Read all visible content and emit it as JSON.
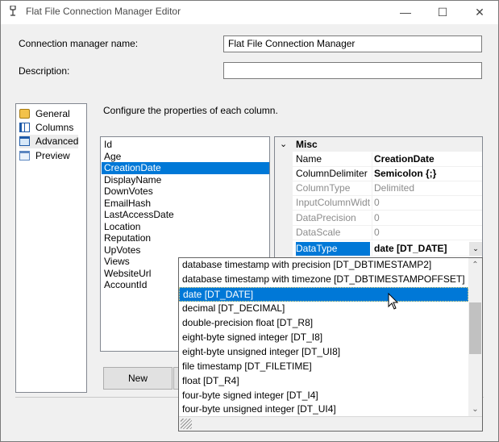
{
  "window": {
    "title": "Flat File Connection Manager Editor",
    "minimize_glyph": "—",
    "maximize_glyph": "☐",
    "close_glyph": "✕"
  },
  "form": {
    "name_label": "Connection manager name:",
    "name_value": "Flat File Connection Manager",
    "desc_label": "Description:",
    "desc_value": ""
  },
  "nav": {
    "items": [
      {
        "label": "General",
        "icon": "general-icon"
      },
      {
        "label": "Columns",
        "icon": "columns-icon"
      },
      {
        "label": "Advanced",
        "icon": "advanced-icon",
        "selected": true
      },
      {
        "label": "Preview",
        "icon": "preview-icon"
      }
    ]
  },
  "main": {
    "instruction": "Configure the properties of each column.",
    "columns": [
      "Id",
      "Age",
      "CreationDate",
      "DisplayName",
      "DownVotes",
      "EmailHash",
      "LastAccessDate",
      "Location",
      "Reputation",
      "UpVotes",
      "Views",
      "WebsiteUrl",
      "AccountId"
    ],
    "selected_column": "CreationDate"
  },
  "grid": {
    "category": "Misc",
    "expand_glyph": "⌄",
    "rows": [
      {
        "name": "Name",
        "value": "CreationDate"
      },
      {
        "name": "ColumnDelimiter",
        "value": "Semicolon {;}"
      },
      {
        "name": "ColumnType",
        "value": "Delimited"
      },
      {
        "name": "InputColumnWidth",
        "value": "0"
      },
      {
        "name": "DataPrecision",
        "value": "0"
      },
      {
        "name": "DataScale",
        "value": "0"
      },
      {
        "name": "DataType",
        "value": "date [DT_DATE]"
      }
    ]
  },
  "buttons": {
    "new_label": "New"
  },
  "dropdown": {
    "options": [
      "database timestamp with precision [DT_DBTIMESTAMP2]",
      "database timestamp with timezone [DT_DBTIMESTAMPOFFSET]",
      "date [DT_DATE]",
      "decimal [DT_DECIMAL]",
      "double-precision float [DT_R8]",
      "eight-byte signed integer [DT_I8]",
      "eight-byte unsigned integer [DT_UI8]",
      "file timestamp [DT_FILETIME]",
      "float [DT_R4]",
      "four-byte signed integer [DT_I4]",
      "four-byte unsigned integer [DT_UI4]"
    ],
    "selected": "date [DT_DATE]",
    "scroll_up_glyph": "⌃",
    "scroll_down_glyph": "⌄"
  }
}
